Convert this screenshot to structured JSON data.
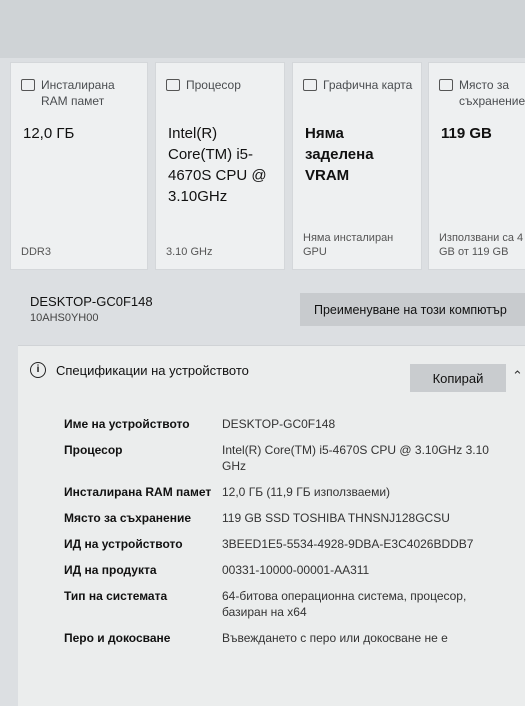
{
  "cards": [
    {
      "title": "Инсталирана RAM памет",
      "value": "12,0 ГБ",
      "footer": "DDR3",
      "icon": "ram-icon"
    },
    {
      "title": "Процесор",
      "value": "Intel(R) Core(TM) i5-4670S CPU @ 3.10GHz",
      "footer": "3.10 GHz",
      "icon": "processor-icon"
    },
    {
      "title": "Графична карта",
      "value": "Няма заделена VRAM",
      "footer": "Няма инсталиран GPU",
      "icon": "graphics-card-icon"
    },
    {
      "title": "Място за съхранение",
      "value": "119 GB",
      "footer": "Използвани са 4 GB от 119 GB",
      "icon": "storage-icon"
    }
  ],
  "device": {
    "name": "DESKTOP-GC0F148",
    "model": "10AHS0YH00",
    "rename_label": "Преименуване на този компютър"
  },
  "specs": {
    "title": "Спецификации на устройството",
    "copy_label": "Копирай",
    "rows": [
      {
        "key": "Име на устройството",
        "value": "DESKTOP-GC0F148"
      },
      {
        "key": "Процесор",
        "value": "Intel(R) Core(TM) i5-4670S CPU @ 3.10GHz 3.10 GHz"
      },
      {
        "key": "Инсталирана RAM памет",
        "value": "12,0 ГБ (11,9 ГБ използваеми)"
      },
      {
        "key": "Място за съхранение",
        "value": "119 GB SSD TOSHIBA THNSNJ128GCSU"
      },
      {
        "key": "ИД на устройството",
        "value": "3BEED1E5-5534-4928-9DBA-E3C4026BDDB7"
      },
      {
        "key": "ИД на продукта",
        "value": "00331-10000-00001-AA311"
      },
      {
        "key": "Тип на системата",
        "value": "64-битова операционна система, процесор, базиран на x64"
      },
      {
        "key": "Перо и докосване",
        "value": "Въвеждането с перо или докосване не е"
      }
    ]
  }
}
